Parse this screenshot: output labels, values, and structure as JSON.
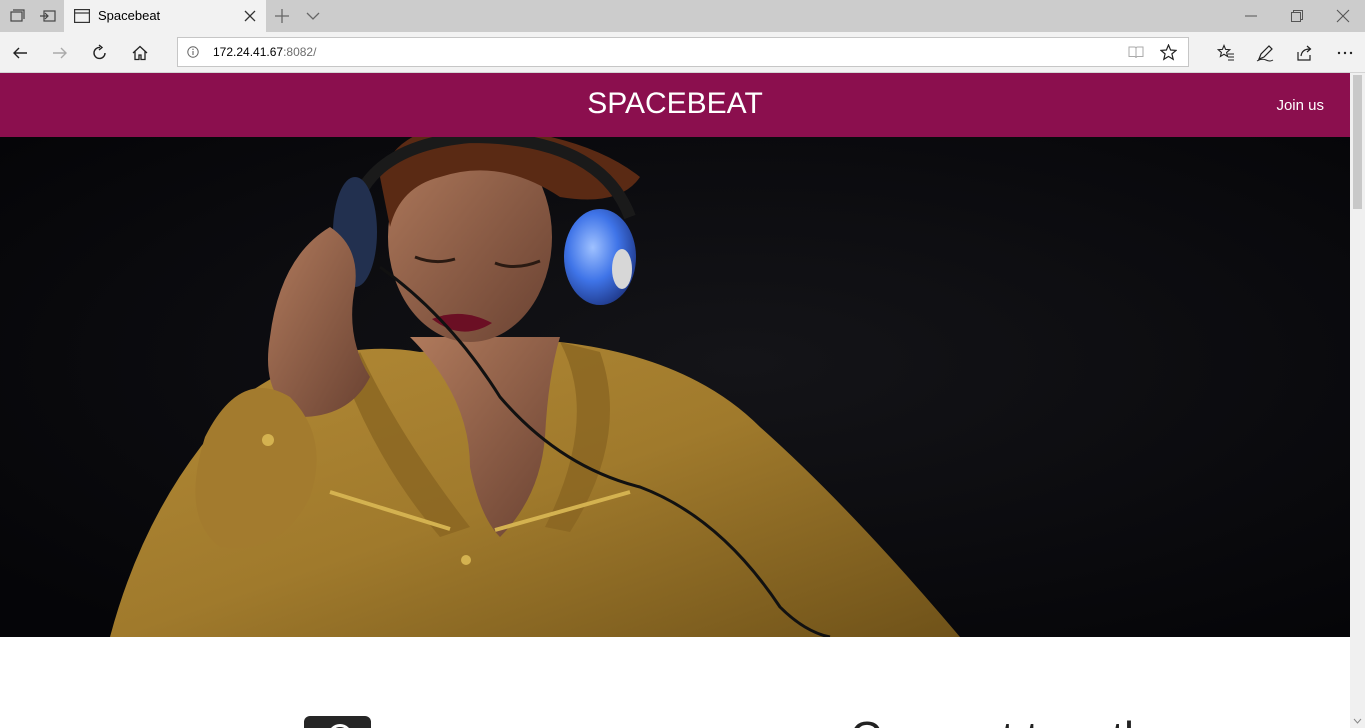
{
  "browser": {
    "tab_title": "Spacebeat",
    "url_host": "172.24.41.67",
    "url_rest": ":8082/"
  },
  "header": {
    "title": "SPACEBEAT",
    "join_label": "Join us",
    "bg_color": "#8b0f4e"
  },
  "hero": {
    "description": "woman-with-blue-headphones-photo"
  },
  "section": {
    "heading": "Connect together"
  },
  "icons": [
    "tab-set-aside-icon",
    "tab-restore-icon",
    "page-icon",
    "close-icon",
    "new-tab-icon",
    "chevron-down-icon",
    "minimize-icon",
    "restore-icon",
    "close-window-icon",
    "back-icon",
    "forward-icon",
    "refresh-icon",
    "home-icon",
    "info-icon",
    "reading-view-icon",
    "star-icon",
    "favorites-icon",
    "pen-icon",
    "share-icon",
    "more-icon"
  ]
}
